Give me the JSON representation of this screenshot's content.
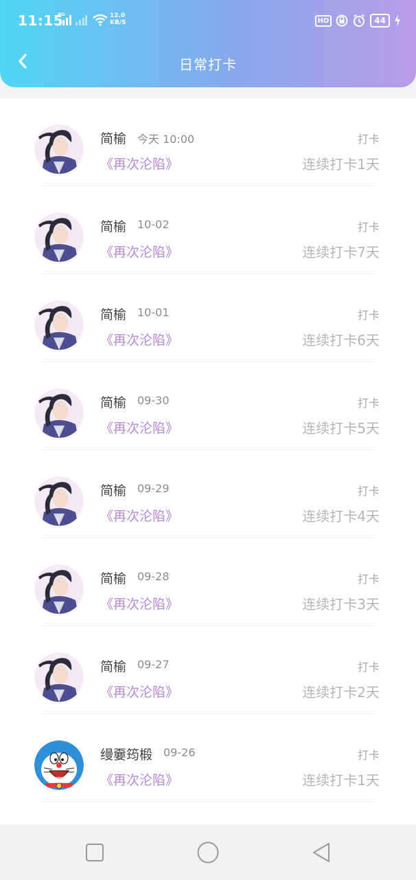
{
  "status_bar": {
    "time": "11:15",
    "network_label": "4G",
    "net_speed_value": "12.0",
    "net_speed_unit": "KB/S",
    "hd_label": "HD",
    "battery": "44"
  },
  "header": {
    "title": "日常打卡",
    "back_icon": "chevron-left-icon"
  },
  "checkins": [
    {
      "name": "简榆",
      "date": "今天 10:00",
      "topic": "《再次沦陷》",
      "action": "打卡",
      "streak": "连续打卡1天",
      "avatar": "anime-avatar"
    },
    {
      "name": "简榆",
      "date": "10-02",
      "topic": "《再次沦陷》",
      "action": "打卡",
      "streak": "连续打卡7天",
      "avatar": "anime-avatar"
    },
    {
      "name": "简榆",
      "date": "10-01",
      "topic": "《再次沦陷》",
      "action": "打卡",
      "streak": "连续打卡6天",
      "avatar": "anime-avatar"
    },
    {
      "name": "简榆",
      "date": "09-30",
      "topic": "《再次沦陷》",
      "action": "打卡",
      "streak": "连续打卡5天",
      "avatar": "anime-avatar"
    },
    {
      "name": "简榆",
      "date": "09-29",
      "topic": "《再次沦陷》",
      "action": "打卡",
      "streak": "连续打卡4天",
      "avatar": "anime-avatar"
    },
    {
      "name": "简榆",
      "date": "09-28",
      "topic": "《再次沦陷》",
      "action": "打卡",
      "streak": "连续打卡3天",
      "avatar": "anime-avatar"
    },
    {
      "name": "简榆",
      "date": "09-27",
      "topic": "《再次沦陷》",
      "action": "打卡",
      "streak": "连续打卡2天",
      "avatar": "anime-avatar"
    },
    {
      "name": "缦嫑筠椴",
      "date": "09-26",
      "topic": "《再次沦陷》",
      "action": "打卡",
      "streak": "连续打卡1天",
      "avatar": "doraemon-avatar"
    }
  ],
  "nav_bar": {
    "recent_icon": "square-icon",
    "home_icon": "circle-icon",
    "back_icon": "triangle-back-icon"
  },
  "colors": {
    "header_start": "#4fd6f4",
    "header_end": "#b99be6",
    "topic": "#b589d6",
    "name": "#444444",
    "muted": "#a8a8a8"
  }
}
